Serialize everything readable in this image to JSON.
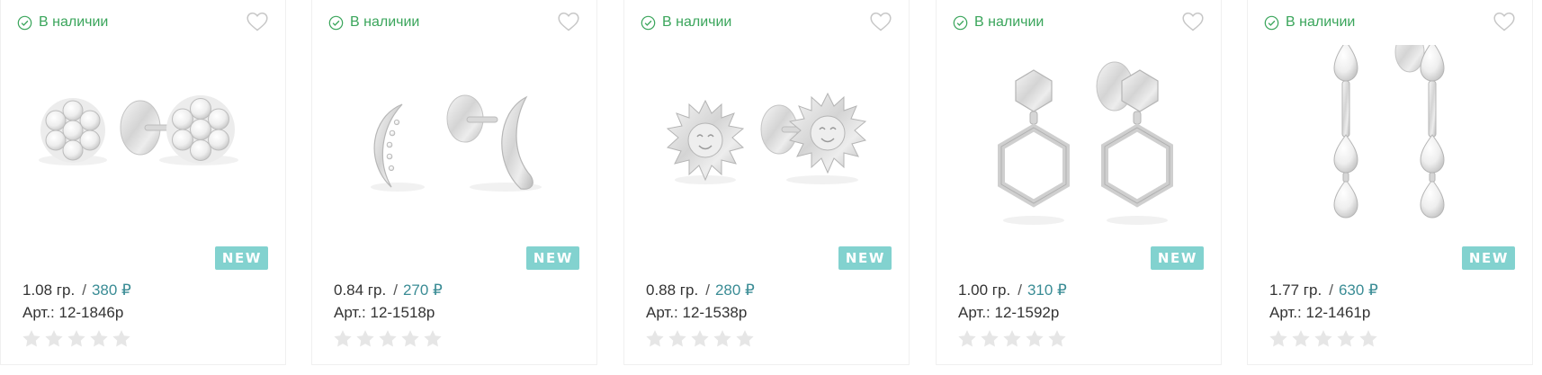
{
  "colors": {
    "stock_green": "#3aa55b",
    "price_teal": "#3a8c95",
    "badge_bg": "#82d2cf",
    "star_empty": "#e6e6e6"
  },
  "icons": {
    "stock": "check-circle-icon",
    "favorite": "heart-outline-icon",
    "rating": "star-icon"
  },
  "products": [
    {
      "stock_label": "В наличии",
      "image": "flower-stud-earrings",
      "badge": "NEW",
      "weight": "1.08 гр.",
      "separator": "/",
      "price": "380 ₽",
      "article": "Арт.: 12-1846р",
      "rating": 0
    },
    {
      "stock_label": "В наличии",
      "image": "moon-stud-earrings",
      "badge": "NEW",
      "weight": "0.84 гр.",
      "separator": "/",
      "price": "270 ₽",
      "article": "Арт.: 12-1518р",
      "rating": 0
    },
    {
      "stock_label": "В наличии",
      "image": "sun-stud-earrings",
      "badge": "NEW",
      "weight": "0.88 гр.",
      "separator": "/",
      "price": "280 ₽",
      "article": "Арт.: 12-1538р",
      "rating": 0
    },
    {
      "stock_label": "В наличии",
      "image": "hexagon-drop-earrings",
      "badge": "NEW",
      "weight": "1.00 гр.",
      "separator": "/",
      "price": "310 ₽",
      "article": "Арт.: 12-1592р",
      "rating": 0
    },
    {
      "stock_label": "В наличии",
      "image": "crystal-drop-earrings",
      "badge": "NEW",
      "weight": "1.77 гр.",
      "separator": "/",
      "price": "630 ₽",
      "article": "Арт.: 12-1461р",
      "rating": 0
    }
  ]
}
